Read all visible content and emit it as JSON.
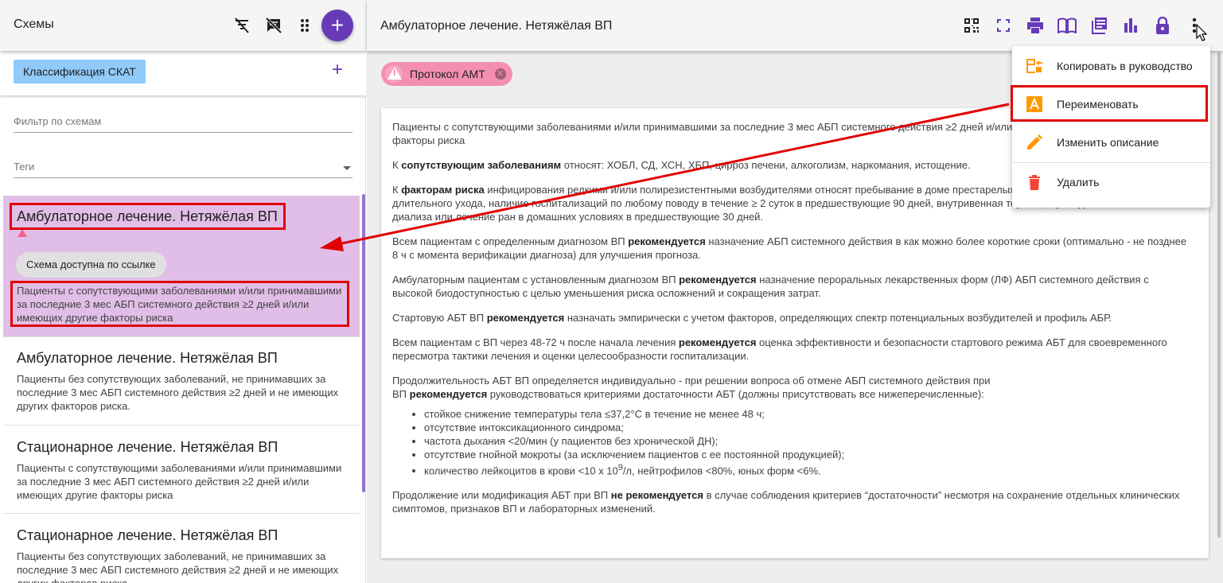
{
  "left_panel": {
    "title": "Схемы",
    "icons": [
      "filter-off-icon",
      "comment-off-icon",
      "drag-handle-icon"
    ],
    "add_button": "+",
    "classification_chip": "Классификация СКАТ",
    "add_classification": "+",
    "filter_placeholder": "Фильтр по схемам",
    "tags_placeholder": "Теги",
    "schemes": [
      {
        "title": "Амбулаторное лечение. Нетяжёлая ВП",
        "badge": "Схема доступна по ссылке",
        "description": "Пациенты с сопутствующими заболеваниями и/или принимавшими за последние 3 мес АБП системного действия ≥2 дней и/или имеющих другие факторы риска",
        "selected": true
      },
      {
        "title": "Амбулаторное лечение. Нетяжёлая ВП",
        "description": "Пациенты без сопутствующих заболеваний, не принимавших за последние 3 мес АБП системного действия ≥2 дней и не имеющих других факторов риска."
      },
      {
        "title": "Стационарное лечение. Нетяжёлая ВП",
        "description": "Пациенты с сопутствующими заболеваниями и/или принимавшими за последние 3 мес АБП системного действия ≥2 дней и/или имеющих другие факторы риска"
      },
      {
        "title": "Стационарное лечение. Нетяжёлая ВП",
        "description": "Пациенты без сопутствующих заболеваний, не принимавших за последние 3 мес АБП системного действия ≥2 дней и не имеющих других факторов риска."
      }
    ]
  },
  "right_panel": {
    "title": "Амбулаторное лечение. Нетяжёлая ВП",
    "toolbar_icons": [
      "qr-code-icon",
      "fullscreen-icon",
      "print-icon",
      "book-icon",
      "library-icon",
      "bar-chart-icon",
      "lock-icon",
      "more-vert-icon"
    ],
    "protocol_chip": "Протокол АМТ",
    "content": {
      "p1": "Пациенты с сопутствующими заболеваниями и/или принимавшими за последние 3 мес АБП системного действия ≥2 дней и/или имеющих другие",
      "p1b": "факторы риска",
      "p2_pre": "К ",
      "p2_bold": "сопутствующим заболеваниям",
      "p2_post": " относят: ХОБЛ, СД, ХСН, ХБП, цирроз печени, алкоголизм, наркомания, истощение.",
      "p3_pre": "К ",
      "p3_bold": "факторам риска",
      "p3_post": " инфицирования редкими и/или полирезистентными возбудителями относят пребывание в доме престарелых или других учреждениях длительного ухода, наличие госпитализаций по любому поводу в течение ≥ 2 суток в предшествующие 90 дней, внутривенная терапия, проведение сеансов диализа или лечение ран в домашних условиях в предшествующие 30 дней.",
      "p4_pre": "Всем пациентам с определенным диагнозом ВП ",
      "p4_bold": "рекомендуется",
      "p4_post": " назначение АБП системного действия в как можно более короткие сроки (оптимально - не позднее 8 ч с момента верификации диагноза) для улучшения прогноза.",
      "p5_pre": "Амбулаторным пациентам с установленным диагнозом ВП ",
      "p5_bold": "рекомендуется",
      "p5_post": " назначение пероральных лекарственных форм (ЛФ) АБП системного действия с высокой биодоступностью с целью уменьшения риска осложнений и сокращения затрат.",
      "p6_pre": "Стартовую АБТ ВП ",
      "p6_bold": "рекомендуется",
      "p6_post": " назначать эмпирически с учетом факторов, определяющих спектр потенциальных возбудителей и профиль АБР.",
      "p7_pre": "Всем пациентам с ВП через 48-72 ч после начала лечения ",
      "p7_bold": "рекомендуется",
      "p7_post": " оценка эффективности и безопасности стартового режима АБТ для своевременного пересмотра тактики лечения и оценки целесообразности госпитализации.",
      "p8_line1": "Продолжительность АБТ ВП определяется индивидуально  - при решении вопроса об отмене АБП системного действия при",
      "p8_pre": "ВП ",
      "p8_bold": "рекомендуется",
      "p8_post": " руководствоваться критериями достаточности АБТ (должны присутствовать все нижеперечисленные):",
      "list": [
        "стойкое снижение температуры тела ≤37,2°С  в течение не менее 48 ч;",
        "отсутствие интоксикационного синдрома;",
        "частота дыхания <20/мин (у пациентов без хронической ДН);",
        "отсутствие гнойной мокроты (за исключением пациентов с ее постоянной продукцией);"
      ],
      "list_last_pre": "количество лейкоцитов в крови <10 х 10",
      "list_last_sup": "9",
      "list_last_post": "/л, нейтрофилов <80%, юных форм <6%.",
      "p9_pre": "Продолжение или модификация АБТ при ВП ",
      "p9_bold": "не рекомендуется",
      "p9_post": "  в случае соблюдения критериев “достаточности” несмотря на сохранение отдельных клинических симптомов, признаков ВП и лабораторных изменений."
    }
  },
  "menu": {
    "items": [
      {
        "label": "Копировать в руководство",
        "icon": "copy-to-guide-icon",
        "color": "#ff9800"
      },
      {
        "label": "Переименовать",
        "icon": "rename-icon",
        "color": "#ff9800"
      },
      {
        "label": "Изменить описание",
        "icon": "edit-icon",
        "color": "#ff9800"
      },
      {
        "label": "Удалить",
        "icon": "delete-icon",
        "color": "#f44336"
      }
    ]
  },
  "colors": {
    "accent": "#673ab7",
    "selected_bg": "#e1bee7",
    "highlight": "#e00000",
    "chip_blue": "#90caf9",
    "chip_pink": "#f48fb1"
  }
}
